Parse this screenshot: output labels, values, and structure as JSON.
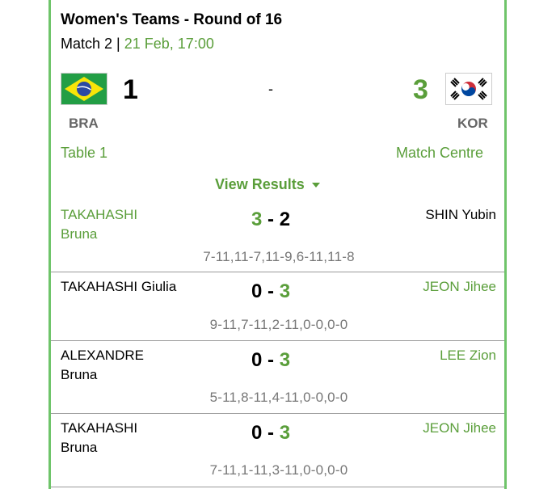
{
  "header": {
    "title": "Women's Teams - Round of 16",
    "match_label": "Match 2",
    "separator": "|",
    "datetime": "21 Feb, 17:00"
  },
  "teams": {
    "home": {
      "code": "BRA",
      "score": "1",
      "flag": "brazil-flag-icon"
    },
    "away": {
      "code": "KOR",
      "score": "3",
      "flag": "south-korea-flag-icon"
    },
    "dash": "-"
  },
  "links": {
    "table": "Table 1",
    "match_centre": "Match Centre",
    "view_results": "View Results"
  },
  "colors": {
    "accent": "#5a9e3a",
    "border": "#6fc46a"
  },
  "games": [
    {
      "home_player": "TAKAHASHI\nBruna",
      "away_player": "SHIN Yubin",
      "home_score": "3",
      "dash": "-",
      "away_score": "2",
      "sets": "7-11,11-7,11-9,6-11,11-8",
      "winner": "home"
    },
    {
      "home_player": "TAKAHASHI Giulia",
      "away_player": "JEON Jihee",
      "home_score": "0",
      "dash": "-",
      "away_score": "3",
      "sets": "9-11,7-11,2-11,0-0,0-0",
      "winner": "away"
    },
    {
      "home_player": "ALEXANDRE\nBruna",
      "away_player": "LEE Zion",
      "home_score": "0",
      "dash": "-",
      "away_score": "3",
      "sets": "5-11,8-11,4-11,0-0,0-0",
      "winner": "away"
    },
    {
      "home_player": "TAKAHASHI\nBruna",
      "away_player": "JEON Jihee",
      "home_score": "0",
      "dash": "-",
      "away_score": "3",
      "sets": "7-11,1-11,3-11,0-0,0-0",
      "winner": "away"
    }
  ]
}
